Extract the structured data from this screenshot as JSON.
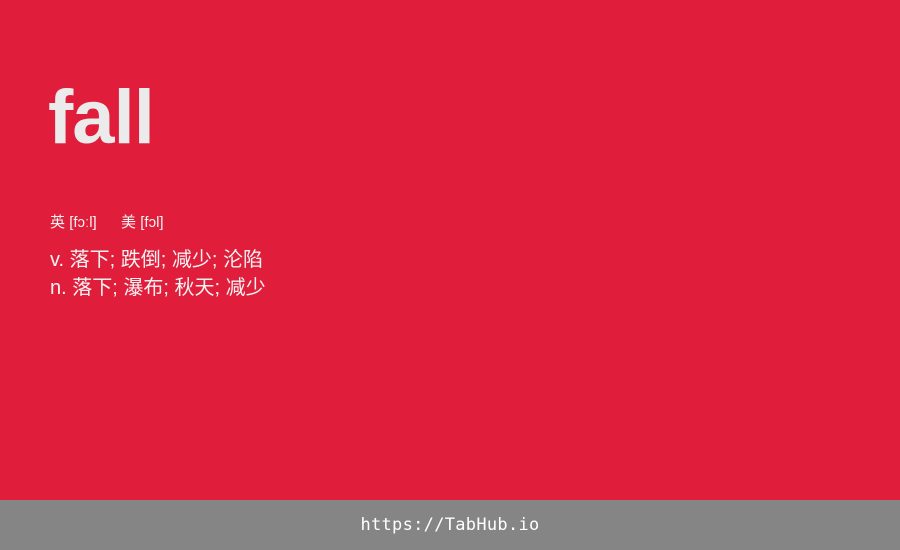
{
  "entry": {
    "word": "fall",
    "phonetics": {
      "uk_label": "英",
      "uk_ipa": "[fɔːl]",
      "us_label": "美",
      "us_ipa": "[fɔl]"
    },
    "definitions": [
      {
        "pos": "v.",
        "meaning": "落下; 跌倒; 减少; 沦陷"
      },
      {
        "pos": "n.",
        "meaning": "落下; 瀑布; 秋天; 减少"
      }
    ]
  },
  "footer": {
    "url": "https://TabHub.io"
  },
  "colors": {
    "background": "#e01e3c",
    "footer_bg": "#858585",
    "text": "#ebebeb"
  }
}
